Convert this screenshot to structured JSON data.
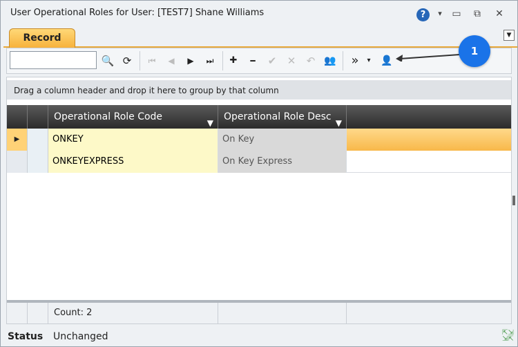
{
  "window": {
    "title": "User Operational Roles for User: [TEST7] Shane Williams"
  },
  "title_controls": {
    "help": "?",
    "dropdown": "▾",
    "minimize": "▭",
    "restore": "⧉",
    "close": "✕"
  },
  "tabs": [
    {
      "label": "Record"
    }
  ],
  "toolbar": {
    "search_value": "",
    "buttons": {
      "search": "🔍",
      "refresh": "⟳",
      "first": "⏮",
      "prev": "◀",
      "next": "▶",
      "last": "⏭",
      "add": "✚",
      "remove": "━",
      "accept": "✔",
      "cancel": "✕",
      "undo": "↶",
      "users": "👥",
      "more": "»",
      "more_dropdown": "▾",
      "user_action": "👤"
    }
  },
  "callout": {
    "label": "1"
  },
  "grid": {
    "group_hint": "Drag a column header and drop it here to group by that column",
    "columns": [
      "Operational Role Code",
      "Operational Role Desc"
    ],
    "rows": [
      {
        "code": "ONKEY",
        "desc": "On Key",
        "selected": true
      },
      {
        "code": "ONKEYEXPRESS",
        "desc": "On Key Express",
        "selected": false
      }
    ],
    "footer": {
      "count": "Count: 2"
    }
  },
  "status": {
    "label": "Status",
    "value": "Unchanged"
  },
  "colors": {
    "tab_active": "#f7b23c",
    "selected_row": "#ffd277",
    "code_cell": "#fdf9c8",
    "desc_cell": "#d9d9d9",
    "callout": "#1a73e8"
  }
}
